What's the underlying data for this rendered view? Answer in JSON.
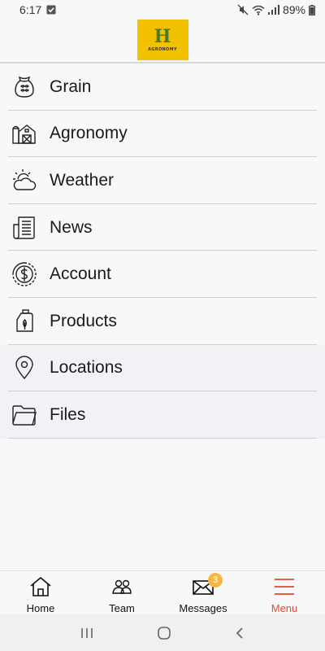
{
  "status": {
    "time": "6:17",
    "battery": "89%",
    "icons": [
      "notification-check-icon",
      "mute-icon",
      "wifi-icon",
      "signal-icon",
      "battery-icon"
    ]
  },
  "header": {
    "logo_letter": "H",
    "logo_text": "AGRONOMY"
  },
  "menu": {
    "items": [
      {
        "label": "Grain",
        "icon": "grain-bag-icon"
      },
      {
        "label": "Agronomy",
        "icon": "barn-icon"
      },
      {
        "label": "Weather",
        "icon": "sun-cloud-icon"
      },
      {
        "label": "News",
        "icon": "newspaper-icon"
      },
      {
        "label": "Account",
        "icon": "dollar-icon"
      },
      {
        "label": "Products",
        "icon": "product-jug-icon"
      },
      {
        "label": "Locations",
        "icon": "location-pin-icon"
      },
      {
        "label": "Files",
        "icon": "folder-icon"
      }
    ]
  },
  "bottom_nav": {
    "tabs": [
      {
        "label": "Home",
        "icon": "home-icon"
      },
      {
        "label": "Team",
        "icon": "team-icon"
      },
      {
        "label": "Messages",
        "icon": "envelope-icon",
        "badge": "3"
      },
      {
        "label": "Menu",
        "icon": "hamburger-icon",
        "active": true
      }
    ]
  },
  "colors": {
    "logo_background": "#f2c200",
    "logo_letter": "#4f7a1e",
    "active_tab": "#e2492d",
    "badge": "#f4b942"
  }
}
